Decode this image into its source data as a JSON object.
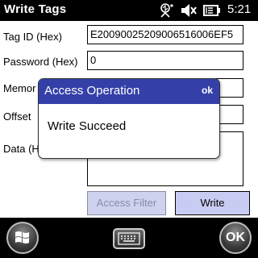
{
  "titlebar": {
    "title": "Write Tags",
    "clock": "5:21",
    "icons": [
      "connectivity-icon",
      "speaker-muted-icon",
      "battery-icon"
    ]
  },
  "form": {
    "tag_id_label": "Tag ID (Hex)",
    "tag_id_value": "E2009002520900651​6006EF5",
    "password_label": "Password (Hex)",
    "password_value": "0",
    "memory_label": "Memor",
    "offset_label": "Offset",
    "data_label": "Data (H",
    "access_filter_label": "Access Filter",
    "write_label": "Write"
  },
  "popup": {
    "title": "Access Operation",
    "ok_label": "ok",
    "message": "Write Succeed"
  },
  "bottombar": {
    "start_icon": "windows-start-icon",
    "keyboard_icon": "keyboard-icon",
    "ok_label": "OK"
  },
  "colors": {
    "popup_header": "#3440a8",
    "button_fill": "#c9ccf2",
    "titlebar": "#000000"
  }
}
